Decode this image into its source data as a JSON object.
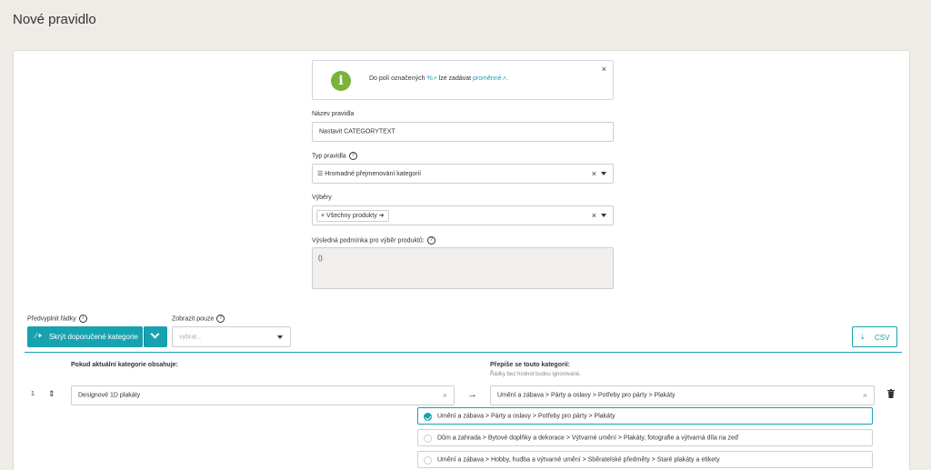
{
  "page": {
    "title": "Nové pravidlo"
  },
  "info": {
    "text_before": "Do polí označených",
    "percent_symbol": "%",
    "text_middle": "lze zadávat",
    "variables_link": "proměnné",
    "text_end": ".",
    "close": "×",
    "icon": "info-icon"
  },
  "form": {
    "name_label": "Název pravidla",
    "name_value": "Nastavit CATEGORYTEXT",
    "type_label": "Typ pravidla",
    "type_value": "Hromadné přejmenování kategorií",
    "selections_label": "Výběry",
    "selection_tag": "Všechny produkty",
    "result_label": "Výsledná podmínka pro výběr produktů:",
    "result_value": "()",
    "clear_symbol": "×",
    "help_symbol": "?"
  },
  "toolbar": {
    "prefill_label": "Předvyplnit řádky",
    "prefill_button": "Skrýt doporučené kategorie",
    "show_only_label": "Zobrazit pouze",
    "show_only_placeholder": "vybrat...",
    "csv_button": "CSV",
    "info_symbol": "i"
  },
  "rules": {
    "left_header": "Pokud aktuální kategorie obsahuje:",
    "right_header": "Přepíše se touto kategorií:",
    "right_sub": "Řádky bez hodnot budou ignorované.",
    "rows": [
      {
        "index": "1",
        "source": "Designové 1D plakáty",
        "target": "Umění a zábava > Párty a oslavy > Potřeby pro párty > Plakáty",
        "arrow": "→"
      }
    ]
  },
  "suggestions": [
    {
      "text": "Umění a zábava > Párty a oslavy > Potřeby pro párty > Plakáty",
      "selected": true
    },
    {
      "text": "Dům a zahrada > Bytové doplňky a dekorace > Výtvarné umění > Plakáty, fotografie a výtvarná díla na zeď",
      "selected": false
    },
    {
      "text": "Umění a zábava > Hobby, hudba a výtvarné umění > Sběratelské předměty > Staré plakáty a etikety",
      "selected": false
    }
  ],
  "colors": {
    "accent": "#17a2b0",
    "info_green": "#7ab33a",
    "background": "#efece7"
  }
}
